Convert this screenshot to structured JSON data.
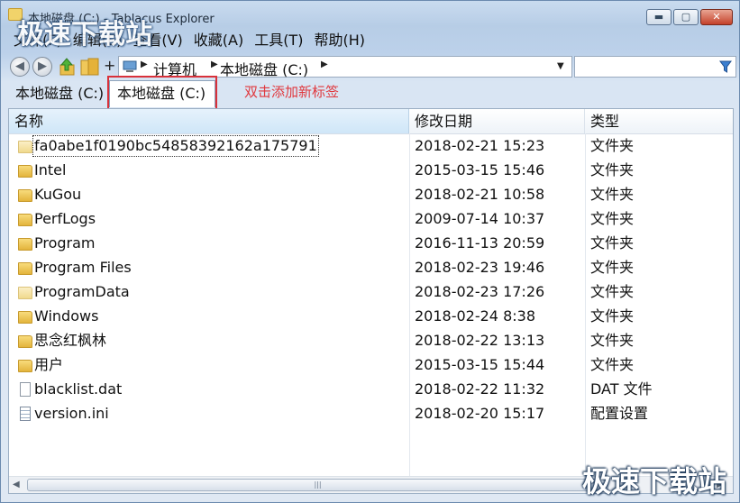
{
  "window": {
    "title": "本地磁盘 (C:) - Tablacus Explorer",
    "buttons": {
      "minimize": "▬",
      "maximize": "▢",
      "close": "✕"
    }
  },
  "menu": [
    "文件(F)",
    "编辑(E)",
    "查看(V)",
    "收藏(A)",
    "工具(T)",
    "帮助(H)"
  ],
  "navigation": {
    "back_icon": "back-arrow-icon",
    "forward_icon": "forward-arrow-icon",
    "plus": "+",
    "breadcrumbs": [
      "计算机",
      "本地磁盘 (C:)"
    ],
    "search_placeholder": ""
  },
  "tabs": [
    {
      "label": "本地磁盘 (C:)",
      "active": false
    },
    {
      "label": "本地磁盘 (C:)",
      "active": true
    }
  ],
  "tab_note": "双击添加新标签",
  "columns": {
    "name": "名称",
    "modified": "修改日期",
    "type": "类型"
  },
  "files": [
    {
      "name": "fa0abe1f0190bc54858392162a175791",
      "modified": "2018-02-21 15:23",
      "type": "文件夹",
      "icon": "folder-pale"
    },
    {
      "name": "Intel",
      "modified": "2015-03-15 15:46",
      "type": "文件夹",
      "icon": "folder"
    },
    {
      "name": "KuGou",
      "modified": "2018-02-21 10:58",
      "type": "文件夹",
      "icon": "folder"
    },
    {
      "name": "PerfLogs",
      "modified": "2009-07-14 10:37",
      "type": "文件夹",
      "icon": "folder"
    },
    {
      "name": "Program",
      "modified": "2016-11-13 20:59",
      "type": "文件夹",
      "icon": "folder"
    },
    {
      "name": "Program Files",
      "modified": "2018-02-23 19:46",
      "type": "文件夹",
      "icon": "folder"
    },
    {
      "name": "ProgramData",
      "modified": "2018-02-23 17:26",
      "type": "文件夹",
      "icon": "folder-pale"
    },
    {
      "name": "Windows",
      "modified": "2018-02-24 8:38",
      "type": "文件夹",
      "icon": "folder"
    },
    {
      "name": "思念红枫林",
      "modified": "2018-02-22 13:13",
      "type": "文件夹",
      "icon": "folder"
    },
    {
      "name": "用户",
      "modified": "2015-03-15 15:44",
      "type": "文件夹",
      "icon": "folder"
    },
    {
      "name": "blacklist.dat",
      "modified": "2018-02-22 11:32",
      "type": "DAT 文件",
      "icon": "file"
    },
    {
      "name": "version.ini",
      "modified": "2018-02-20 15:17",
      "type": "配置设置",
      "icon": "ini"
    }
  ],
  "scrollbar": {
    "left": "◀",
    "right": "▶",
    "grip": "|||"
  },
  "watermark_top": "极速下载站",
  "watermark_bottom": "极速下载站"
}
